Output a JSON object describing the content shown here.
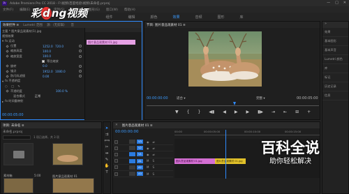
{
  "window": {
    "app_title": "Adobe Premiere Pro CC 2018 - F:\\视频\\百度经验\\视频\\未命名.prproj",
    "app_icon": "Pr",
    "controls": [
      "—",
      "□",
      "✕"
    ]
  },
  "menu": [
    "文件(F)",
    "编辑(E)",
    "剪辑(C)",
    "序列(S)",
    "标记(M)",
    "图形(G)",
    "窗口(W)",
    "帮助(H)"
  ],
  "workspaces": {
    "items": [
      "组件",
      "编辑",
      "颜色",
      "效果",
      "音频",
      "图形",
      "库"
    ],
    "active": "效果"
  },
  "watermark_logo": {
    "text_left": "彩",
    "text_mid": "d",
    "text_right": "ng视频"
  },
  "effect_controls": {
    "tabs": [
      "效果控件 ≡",
      "Lumetri 范围",
      "源:（无剪辑）",
      "音"
    ],
    "source_label": "主要 * 图片意品观素材(1).jpg",
    "seq_label": "图片意品观素材 01 * 图片意品观素材 01.jpg",
    "section_video": "视频效果",
    "section_motion": "fx  运动",
    "clip_label": "图片意品观素材 01.jpg",
    "rows": [
      {
        "label": "位置",
        "v1": "1252.0",
        "v2": "720.0",
        "reset": true,
        "kf": true
      },
      {
        "label": "缩放高度",
        "v1": "100.0",
        "v2": "",
        "reset": true,
        "kf": true
      },
      {
        "label": "缩放宽度",
        "v1": "100.0",
        "v2": "",
        "reset": true,
        "kf": false
      },
      {
        "label": "",
        "v1": "",
        "v2": "",
        "reset": false,
        "kf": false,
        "checkbox_label": "等比缩放"
      },
      {
        "label": "旋转",
        "v1": "0.0",
        "v2": "",
        "reset": true,
        "kf": true
      },
      {
        "label": "锚点",
        "v1": "1952.0",
        "v2": "1080.0",
        "reset": true,
        "kf": true
      },
      {
        "label": "防闪烁滤镜",
        "v1": "0.00",
        "v2": "",
        "reset": true,
        "kf": true
      }
    ],
    "section_opacity": "fx  不透明度",
    "opacity_row": {
      "label": "不透明度",
      "value": "100.0 %"
    },
    "blend_row": {
      "label": "混合模式",
      "value": "正常"
    },
    "section_time": "fx  时间重映射",
    "timecode": "00:00:05:00"
  },
  "program_monitor": {
    "tab": "节目: 图片意品观素材 01 ≡",
    "timecode_left": "00:00:00:00",
    "fit": "适合",
    "quality": "完整",
    "timecode_right": "00:00:05:00"
  },
  "transport": [
    "◀▮",
    "◀",
    "▶",
    "▶",
    "▮▶",
    "⇥",
    "⇤",
    "⊞",
    "⧉",
    "+"
  ],
  "right_panel": {
    "header": "»",
    "items": [
      "效果",
      "基本图形",
      "基本声音",
      "Lumetri 颜色",
      "库",
      "标记",
      "历史记录",
      "信息"
    ]
  },
  "project_panel": {
    "tab": "项目: 未命名 ≡",
    "file": "未命名.prproj",
    "count": "1 项已选择，共 3 项",
    "items": [
      {
        "name": "素材箱",
        "meta": ""
      },
      {
        "name": "图片意品观素材...",
        "meta": "5:00"
      },
      {
        "name": "图片意品观素材 01",
        "meta": "5:00"
      }
    ]
  },
  "timeline": {
    "tab": "图片意品观素材 01 ≡",
    "timecode": "00:00:00:00",
    "ruler": [
      "00:00",
      "00:00:05:00",
      "00:00:10:00",
      "00:00:15:00"
    ],
    "tracks": [
      "V3",
      "V2",
      "V1",
      "A1",
      "A2",
      "A3"
    ],
    "clip_v1": "图片意品观素材 01.jpg",
    "clip_a1": "图片意品观素材 01.jpg"
  },
  "brand_watermark": {
    "title": "百科全说",
    "subtitle": "助你轻松解决"
  },
  "colors": {
    "accent": "#3b9bff",
    "clip_pink": "#d46fd3",
    "clip_yellow": "#e1c12a",
    "playhead": "#2f8bff"
  }
}
